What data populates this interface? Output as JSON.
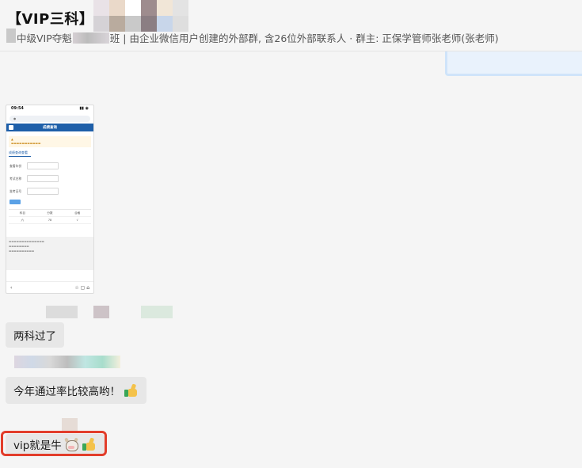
{
  "header": {
    "title": "【VIP三科】",
    "subtitle_prefix": "中级VIP夺魁",
    "subtitle_mid": "班",
    "subtitle_rest": " | 由企业微信用户创建的外部群, 含26位外部联系人 · 群主: 正保学管师张老师(张老师)"
  },
  "colors": {
    "highlight": "#e23d2b",
    "bubble_bg": "#e7e7e7",
    "brand_nav": "#1e5fa9"
  },
  "screenshot": {
    "time": "09:54",
    "nav_title": "成绩查询",
    "tab_label": "成绩查询查看",
    "rows": [
      {
        "label": "查看年份"
      },
      {
        "label": "考试名称"
      },
      {
        "label": "准考证号"
      }
    ],
    "table_headers": [
      "科目",
      "分数",
      "合格"
    ],
    "table_values": [
      "六",
      "78",
      "√"
    ]
  },
  "messages": [
    {
      "text": "两科过了"
    },
    {
      "text": "今年通过率比较高哟！"
    },
    {
      "text": "vip就是牛"
    }
  ]
}
